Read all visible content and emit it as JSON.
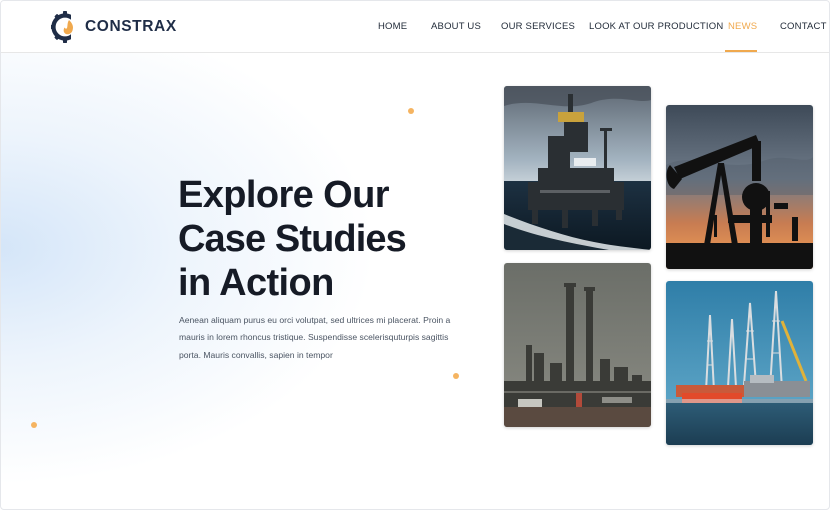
{
  "brand": {
    "name": "CONSTRAX",
    "logo_icon": "gear-flame-icon",
    "colors": {
      "navy": "#1f2d47",
      "accent": "#f0a94e"
    }
  },
  "nav": {
    "items": [
      {
        "label": "HOME"
      },
      {
        "label": "ABOUT US"
      },
      {
        "label": "OUR SERVICES"
      },
      {
        "label": "LOOK AT OUR PRODUCTION"
      },
      {
        "label": "NEWS"
      },
      {
        "label": "CONTACT"
      }
    ],
    "active": "NEWS"
  },
  "hero": {
    "title_line1": "Explore Our",
    "title_line2": "Case Studies",
    "title_line3": "in Action",
    "description": "Aenean aliquam purus eu orci volutpat, sed ultrices mi placerat. Proin a mauris in lorem rhoncus tristique. Suspendisse scelerisquturpis sagittis porta. Mauris convallis, sapien in tempor"
  },
  "gallery": {
    "images": [
      {
        "subject": "offshore-oil-platform"
      },
      {
        "subject": "oil-pumpjack-at-sunset"
      },
      {
        "subject": "refinery-smokestacks"
      },
      {
        "subject": "drilling-rigs-in-harbor"
      }
    ]
  }
}
